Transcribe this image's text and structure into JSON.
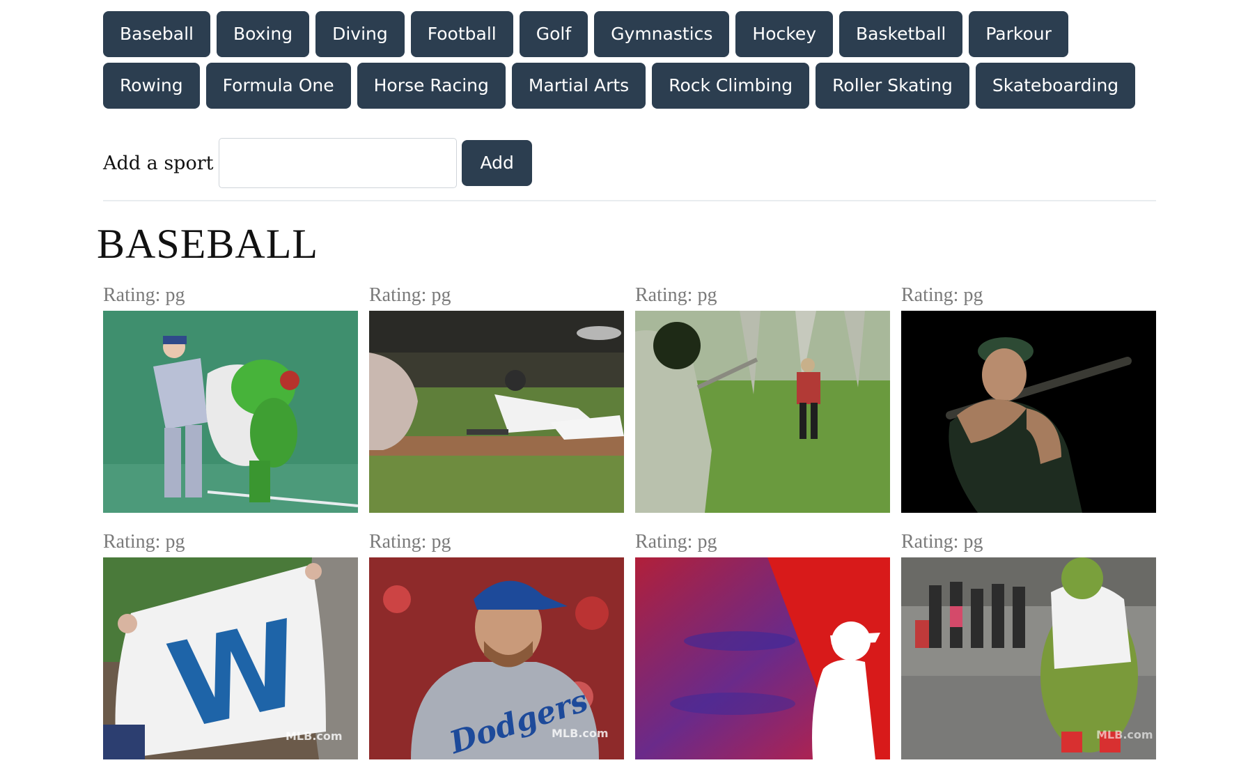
{
  "sports": {
    "row1": [
      "Baseball",
      "Boxing",
      "Diving",
      "Football",
      "Golf",
      "Gymnastics",
      "Hockey",
      "Basketball",
      "Parkour"
    ],
    "row2": [
      "Rowing",
      "Formula One",
      "Horse Racing",
      "Martial Arts",
      "Rock Climbing",
      "Roller Skating",
      "Skateboarding"
    ]
  },
  "add_form": {
    "label": "Add a sport",
    "input_value": "",
    "button_label": "Add"
  },
  "section": {
    "title": "BASEBALL"
  },
  "gifs": [
    {
      "rating": "Rating: pg",
      "subject": "manager-tackling-mascot"
    },
    {
      "rating": "Rating: pg",
      "subject": "player-sliding-into-base"
    },
    {
      "rating": "Rating: pg",
      "subject": "backyard-batting"
    },
    {
      "rating": "Rating: pg",
      "subject": "batter-swinging-black-background"
    },
    {
      "rating": "Rating: pg",
      "subject": "fan-waving-w-flag",
      "overlay_text": "MLB.com"
    },
    {
      "rating": "Rating: pg",
      "subject": "dodgers-pitcher",
      "overlay_text": "MLB.com"
    },
    {
      "rating": "Rating: pg",
      "subject": "mlb-logo-silhouette"
    },
    {
      "rating": "Rating: pg",
      "subject": "mascot-dancing-crowd",
      "overlay_text": "MLB.com"
    }
  ],
  "colors": {
    "button_bg": "#2c3e50",
    "button_text": "#ffffff",
    "rating_text": "#7a7a7a"
  }
}
